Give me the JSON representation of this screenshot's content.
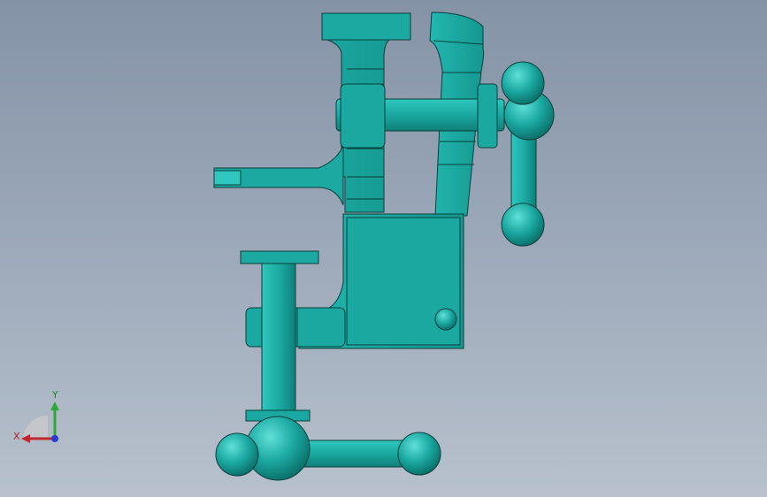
{
  "viewport": {
    "background_top": "#8593a7",
    "background_bottom": "#b8c1cd"
  },
  "model": {
    "part": "bench-vise",
    "color_main": "#1aa8a0",
    "color_light": "#2fc7be",
    "color_dark": "#0f7f79",
    "edge_color": "#0b3f3c"
  },
  "triad": {
    "x_label": "X",
    "y_label": "Y",
    "x_color": "#c0262c",
    "y_color": "#2ea83a",
    "z_color": "#2a3ad4"
  }
}
